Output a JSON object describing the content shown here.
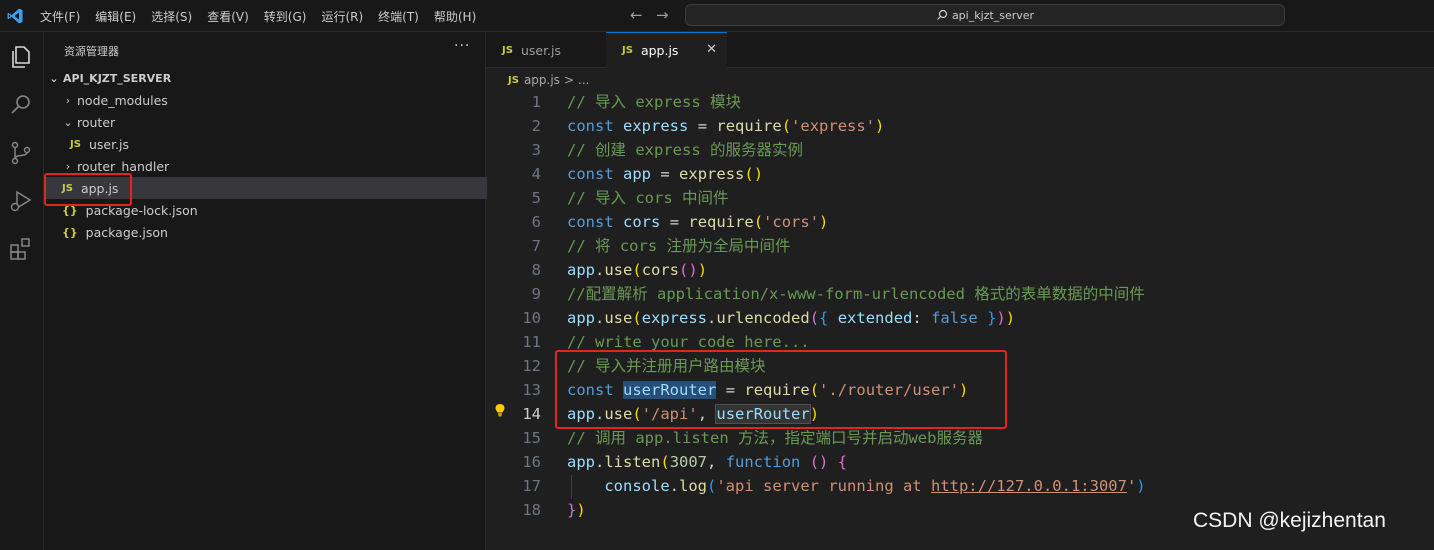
{
  "titlebar": {
    "menu": [
      "文件(F)",
      "编辑(E)",
      "选择(S)",
      "查看(V)",
      "转到(G)",
      "运行(R)",
      "终端(T)",
      "帮助(H)"
    ],
    "search_text": "api_kjzt_server",
    "back_icon": "←",
    "forward_icon": "→"
  },
  "activity_bar": {
    "icons": [
      "explorer-icon",
      "search-icon",
      "source-control-icon",
      "run-debug-icon",
      "extensions-icon"
    ]
  },
  "sidebar": {
    "title": "资源管理器",
    "more_label": "···",
    "root": "API_KJZT_SERVER",
    "items": [
      {
        "label": "node_modules",
        "type": "folder",
        "expanded": false
      },
      {
        "label": "router",
        "type": "folder",
        "expanded": true
      },
      {
        "label": "user.js",
        "type": "js"
      },
      {
        "label": "router_handler",
        "type": "folder",
        "expanded": false
      },
      {
        "label": "app.js",
        "type": "js",
        "selected": true
      },
      {
        "label": "package-lock.json",
        "type": "json"
      },
      {
        "label": "package.json",
        "type": "json"
      }
    ],
    "js_badge": "JS",
    "json_badge": "{}"
  },
  "tabs": [
    {
      "label": "user.js",
      "active": false
    },
    {
      "label": "app.js",
      "active": true
    }
  ],
  "tab_close": "✕",
  "breadcrumb": {
    "file": "app.js",
    "separator": ">",
    "tail": "..."
  },
  "editor": {
    "lines": [
      "1",
      "2",
      "3",
      "4",
      "5",
      "6",
      "7",
      "8",
      "9",
      "10",
      "11",
      "12",
      "13",
      "14",
      "15",
      "16",
      "17",
      "18"
    ],
    "current_line": "14"
  },
  "colors": {
    "accent": "#0078d4",
    "highlight_box": "#e3261b",
    "selection": "#264f78"
  },
  "watermark": "CSDN @kejizhentan"
}
